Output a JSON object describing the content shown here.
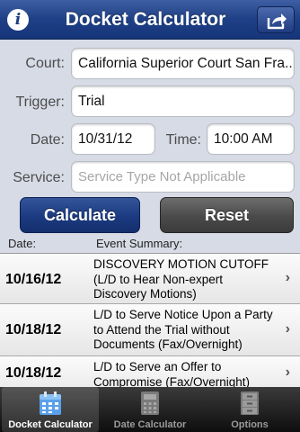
{
  "header": {
    "title": "Docket Calculator",
    "info_glyph": "i",
    "info_icon": "info-icon",
    "share_icon": "share-icon"
  },
  "form": {
    "court_label": "Court:",
    "court_value": "California Superior Court San Fra...",
    "trigger_label": "Trigger:",
    "trigger_value": "Trial",
    "date_label": "Date:",
    "date_value": "10/31/12",
    "time_label": "Time:",
    "time_value": "10:00 AM",
    "service_label": "Service:",
    "service_placeholder": "Service Type Not Applicable"
  },
  "buttons": {
    "calculate": "Calculate",
    "reset": "Reset"
  },
  "list": {
    "date_header": "Date:",
    "summary_header": "Event Summary:",
    "rows": [
      {
        "date": "10/16/12",
        "lines": [
          "DISCOVERY MOTION CUTOFF",
          "(L/D to Hear Non-expert",
          "Discovery Motions)"
        ]
      },
      {
        "date": "10/18/12",
        "lines": [
          "L/D to Serve Notice Upon a Party",
          "to Attend the Trial without",
          "Documents (Fax/Overnight)"
        ]
      },
      {
        "date": "10/18/12",
        "lines": [
          "L/D to Serve an Offer to",
          "Compromise (Fax/Overnight)"
        ]
      }
    ],
    "chevron": "›"
  },
  "tabs": [
    {
      "label": "Docket Calculator",
      "icon": "calendar-icon",
      "active": true
    },
    {
      "label": "Date Calculator",
      "icon": "calculator-icon",
      "active": false
    },
    {
      "label": "Options",
      "icon": "file-cabinet-icon",
      "active": false
    }
  ],
  "colors": {
    "nav_blue": "#1f3f86",
    "button_blue": "#1b3a80",
    "button_gray": "#4a4a4a",
    "form_background": "#d7dbe6",
    "tabbar_black": "#111111"
  }
}
